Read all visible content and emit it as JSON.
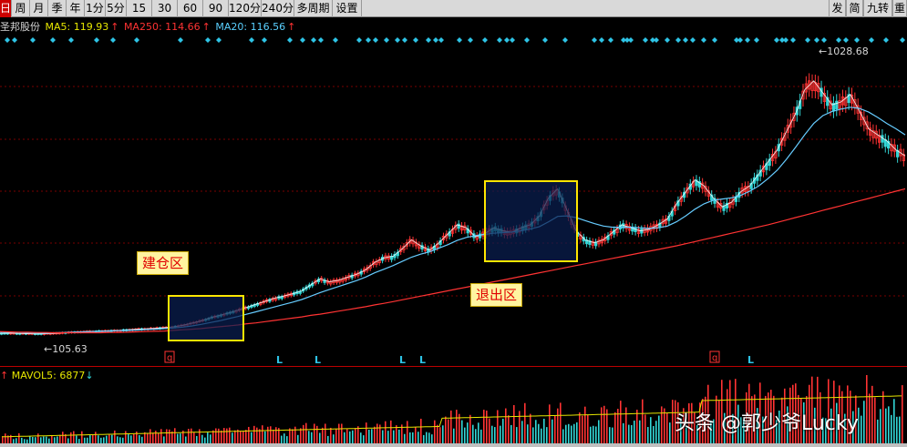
{
  "toolbar": {
    "periods": [
      "日",
      "周",
      "月",
      "季",
      "年",
      "1分",
      "5分",
      "15分",
      "30分",
      "60分",
      "90分",
      "120分",
      "240分",
      "多周期",
      "设置"
    ],
    "active_period": "日",
    "right_buttons": [
      "发",
      "简",
      "九转",
      "重"
    ]
  },
  "stock": {
    "name": "圣邦股份",
    "ma5_label": "MA5: 119.93",
    "ma250_label": "MA250: 114.66",
    "ma20_label": "MA20: 116.56",
    "arrow_up": "↑"
  },
  "annotations": {
    "build_zone_label": "建仓区",
    "exit_zone_label": "退出区",
    "high_label": "1028.68",
    "low_label": "105.63",
    "q_marker": "q",
    "l_marker": "L"
  },
  "volume": {
    "label": "MAVOL5: 6877",
    "arrow_up": "↑",
    "arrow_down": "↓"
  },
  "watermark": "头条 @郭少爷Lucky",
  "colors": {
    "background": "#000000",
    "up_candle": "#ff3333",
    "down_candle": "#33d6d6",
    "ma5": "#ffffff",
    "ma20": "#66ccff",
    "ma250": "#ff3333",
    "signal_dot": "#2ec4e6",
    "highlight_border": "#ffe600",
    "grid": "#7a0000"
  },
  "chart_data": {
    "type": "line",
    "ylim": [
      60,
      1080
    ],
    "x": [
      0,
      10,
      20,
      30,
      40,
      50,
      60,
      70,
      80,
      90,
      100,
      110,
      120,
      130,
      140,
      150,
      160,
      170,
      180,
      190,
      200,
      210,
      220,
      230,
      240,
      250,
      260,
      270,
      280,
      290,
      300,
      310,
      320,
      330,
      340,
      350,
      360,
      370,
      380,
      390,
      400,
      410,
      420,
      430,
      440,
      450,
      460,
      470,
      480,
      490,
      500,
      510,
      520,
      530,
      540,
      550,
      560,
      570,
      580,
      590,
      600,
      610,
      620,
      630,
      640,
      650,
      660,
      670,
      680,
      690,
      700,
      710,
      720,
      730,
      740,
      750,
      760,
      770,
      780,
      790,
      800,
      810,
      820,
      830,
      840,
      850,
      860,
      870,
      880,
      890,
      900,
      910,
      920,
      930,
      940,
      950,
      960,
      970,
      980,
      990
    ],
    "series": [
      {
        "name": "MA5",
        "values": [
          108,
          109,
          108,
          107,
          106,
          107,
          108,
          110,
          112,
          113,
          115,
          116,
          117,
          118,
          120,
          122,
          123,
          125,
          127,
          130,
          135,
          142,
          150,
          160,
          168,
          176,
          185,
          195,
          205,
          215,
          225,
          232,
          240,
          250,
          270,
          290,
          280,
          285,
          295,
          305,
          320,
          345,
          360,
          365,
          390,
          420,
          400,
          385,
          410,
          440,
          470,
          460,
          430,
          440,
          460,
          450,
          445,
          460,
          470,
          500,
          560,
          590,
          520,
          450,
          420,
          410,
          420,
          445,
          470,
          460,
          450,
          455,
          470,
          490,
          540,
          580,
          620,
          600,
          560,
          530,
          545,
          580,
          600,
          640,
          680,
          720,
          780,
          840,
          920,
          950,
          910,
          870,
          880,
          905,
          850,
          790,
          770,
          750,
          720,
          700
        ]
      },
      {
        "name": "MA20",
        "values": [
          112,
          112,
          111,
          110,
          110,
          109,
          110,
          111,
          112,
          113,
          114,
          115,
          116,
          117,
          118,
          119,
          121,
          122,
          124,
          126,
          129,
          133,
          138,
          144,
          150,
          157,
          164,
          172,
          180,
          188,
          196,
          204,
          212,
          221,
          232,
          244,
          254,
          264,
          274,
          284,
          296,
          310,
          322,
          334,
          348,
          362,
          372,
          380,
          392,
          404,
          418,
          428,
          434,
          438,
          442,
          444,
          446,
          450,
          456,
          464,
          480,
          498,
          500,
          494,
          484,
          474,
          466,
          462,
          462,
          462,
          460,
          458,
          460,
          466,
          480,
          500,
          522,
          540,
          552,
          556,
          560,
          568,
          582,
          600,
          624,
          652,
          688,
          728,
          770,
          808,
          834,
          848,
          856,
          862,
          858,
          846,
          828,
          808,
          790,
          770
        ]
      },
      {
        "name": "MA250",
        "values": [
          114,
          113,
          112,
          112,
          111,
          111,
          110,
          110,
          110,
          110,
          110,
          110,
          111,
          111,
          112,
          113,
          114,
          115,
          116,
          118,
          120,
          122,
          124,
          127,
          130,
          133,
          136,
          140,
          143,
          147,
          151,
          155,
          159,
          163,
          168,
          172,
          177,
          182,
          187,
          192,
          197,
          203,
          208,
          214,
          220,
          226,
          232,
          238,
          244,
          250,
          256,
          262,
          268,
          274,
          280,
          286,
          292,
          298,
          304,
          310,
          316,
          322,
          328,
          334,
          340,
          346,
          352,
          358,
          364,
          370,
          376,
          382,
          388,
          394,
          400,
          407,
          414,
          421,
          428,
          435,
          442,
          449,
          456,
          463,
          470,
          478,
          486,
          494,
          502,
          510,
          518,
          526,
          534,
          542,
          550,
          558,
          566,
          574,
          582,
          590
        ]
      }
    ]
  }
}
